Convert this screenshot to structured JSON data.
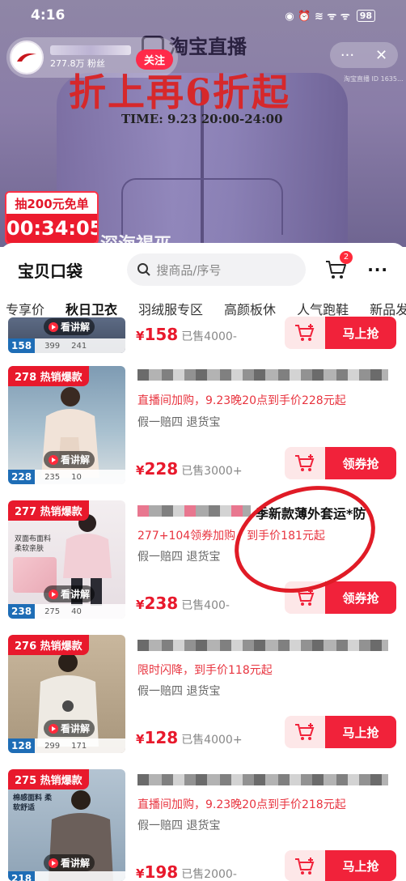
{
  "status_bar": {
    "time": "4:16",
    "battery": "98",
    "icons": "◉ ⏰ ≋ ᯤ ᯤ"
  },
  "live": {
    "platform_logo": "淘宝直播",
    "anchor_fans": "277.8万 粉丝",
    "follow_label": "关注",
    "more_label": "···",
    "close_label": "✕",
    "room_id": "淘宝直播 ID 1635...",
    "promo_title": "折上再6折起",
    "promo_time": "TIME: 9.23 20:00-24:00",
    "free_badge_title": "抽200元免单",
    "free_badge_timer": "00:34:05",
    "caption": "深海褐巫"
  },
  "panel": {
    "title": "宝贝口袋",
    "search_placeholder": "搜商品/序号",
    "cart_count": "2",
    "more_label": "···",
    "tabs": [
      "专享价",
      "秋日卫衣",
      "羽绒服专区",
      "高颜板休",
      "人气跑鞋",
      "新品发"
    ]
  },
  "items": [
    {
      "price": "158",
      "sold": "已售4000-",
      "button": "马上抢",
      "explain": "看讲解",
      "strip_price": "158",
      "strip_nums": [
        "399",
        "241"
      ]
    },
    {
      "tag": "278 热销爆款",
      "promo": "直播间加购，9.23晚20点到手价228元起",
      "guarantee": "假一赔四  退货宝",
      "price": "228",
      "sold": "已售3000+",
      "button": "领券抢",
      "explain": "看讲解",
      "strip_price": "228",
      "strip_nums": [
        "235",
        "10"
      ]
    },
    {
      "tag": "277 热销爆款",
      "title_visible": "季新款薄外套运*防",
      "promo": "277+104领券加购，到手价181元起",
      "guarantee": "假一赔四  退货宝",
      "price": "238",
      "sold": "已售400-",
      "button": "领券抢",
      "explain": "看讲解",
      "strip_price": "238",
      "strip_nums": [
        "275",
        "40"
      ],
      "fabric_text": "双面布面料 柔软亲肤"
    },
    {
      "tag": "276 热销爆款",
      "promo": "限时闪降，到手价118元起",
      "guarantee": "假一赔四  退货宝",
      "price": "128",
      "sold": "已售4000+",
      "button": "马上抢",
      "explain": "看讲解",
      "strip_price": "128",
      "strip_nums": [
        "299",
        "171"
      ]
    },
    {
      "tag": "275 热销爆款",
      "promo": "直播间加购，9.23晚20点到手价218元起",
      "guarantee": "假一赔四  退货宝",
      "price": "198",
      "sold": "已售2000-",
      "button": "马上抢",
      "explain": "看讲解",
      "strip_price": "218",
      "fabric_text": "棉感面料 柔软舒适"
    }
  ],
  "colors": {
    "accent": "#f1223a",
    "promo_text": "#e8343f",
    "live_bg": "#8a7da8"
  }
}
